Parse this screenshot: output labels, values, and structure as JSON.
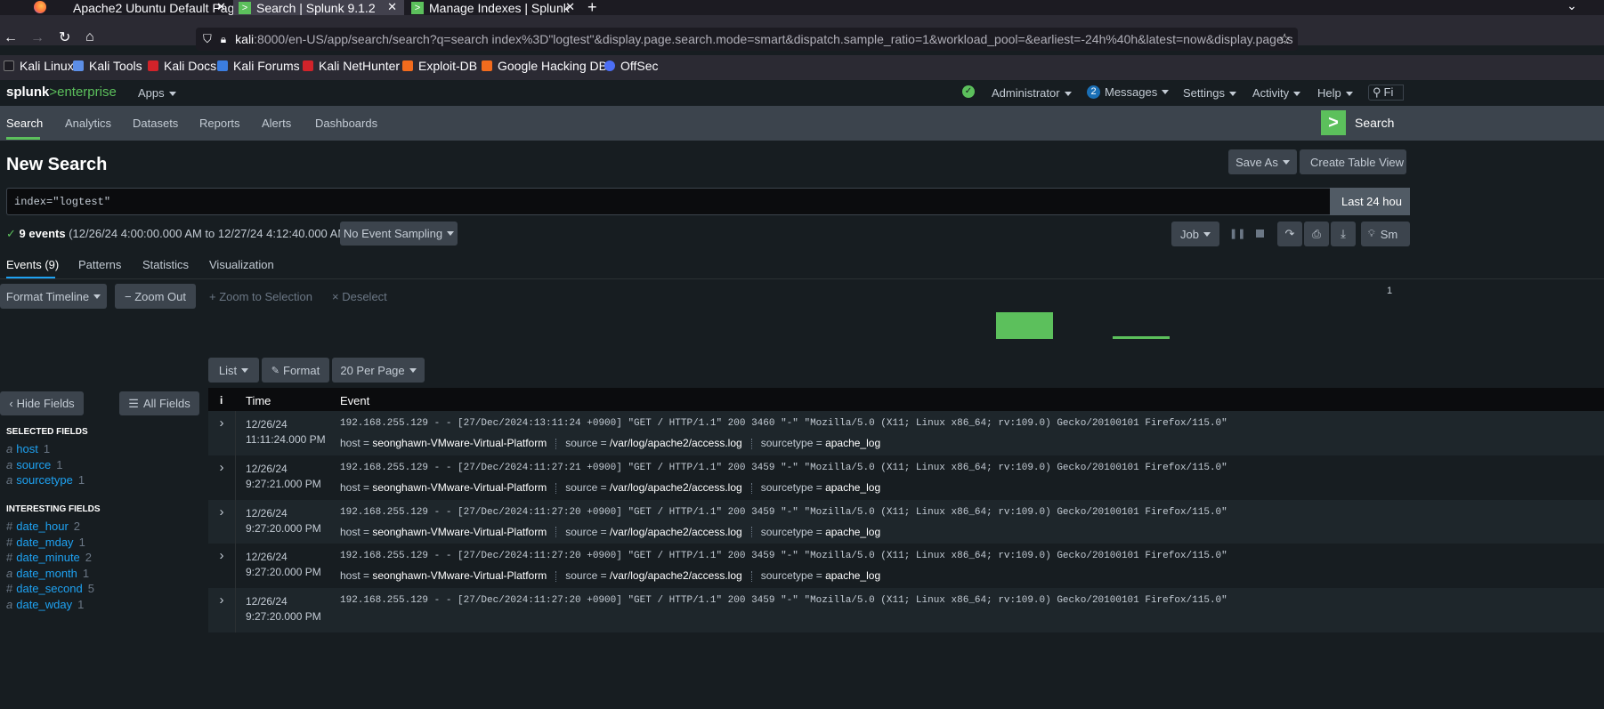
{
  "browser": {
    "tabs": [
      {
        "label": "Apache2 Ubuntu Default Pag"
      },
      {
        "label": "Search | Splunk 9.1.2"
      },
      {
        "label": "Manage Indexes | Splunk"
      }
    ],
    "new_tab": "+",
    "url_host": "kali",
    "url_rest": ":8000/en-US/app/search/search?q=search index%3D\"logtest\"&display.page.search.mode=smart&dispatch.sample_ratio=1&workload_pool=&earliest=-24h%40h&latest=now&display.page.s",
    "bookmarks": [
      {
        "label": "Kali Linux",
        "color": "#2b2a33"
      },
      {
        "label": "Kali Tools",
        "color": "#5c8ee6"
      },
      {
        "label": "Kali Docs",
        "color": "#d1232a"
      },
      {
        "label": "Kali Forums",
        "color": "#3b7de0"
      },
      {
        "label": "Kali NetHunter",
        "color": "#d1232a"
      },
      {
        "label": "Exploit-DB",
        "color": "#f26b1d"
      },
      {
        "label": "Google Hacking DB",
        "color": "#f26b1d"
      },
      {
        "label": "OffSec",
        "color": "#4c6ef5"
      }
    ]
  },
  "splunk": {
    "logo_a": "splunk",
    "logo_b": ">enterprise",
    "apps": "Apps",
    "user": "Administrator",
    "messages_count": "2",
    "messages": "Messages",
    "settings": "Settings",
    "activity": "Activity",
    "help": "Help",
    "find": "Fi",
    "app_nav": [
      "Search",
      "Analytics",
      "Datasets",
      "Reports",
      "Alerts",
      "Dashboards"
    ],
    "app_title": "Search",
    "accent": "#5cc05c",
    "link_color": "#1ea2f2"
  },
  "search": {
    "page_title": "New Search",
    "save_as": "Save As",
    "create_table": "Create Table View",
    "query": "index=\"logtest\"",
    "time_range": "Last 24 hou",
    "status_count": "9 events",
    "status_range": "(12/26/24 4:00:00.000 AM to 12/27/24 4:12:40.000 AM)",
    "sampling": "No Event Sampling",
    "job": "Job",
    "smart": "Sm"
  },
  "result_tabs": [
    "Events (9)",
    "Patterns",
    "Statistics",
    "Visualization"
  ],
  "timeline": {
    "format": "Format Timeline",
    "zoom_out": "− Zoom Out",
    "zoom_sel": "+ Zoom to Selection",
    "deselect": "× Deselect",
    "scale": "1"
  },
  "events_toolbar": {
    "list": "List",
    "format": "Format",
    "per_page": "20 Per Page"
  },
  "fields": {
    "hide": "Hide Fields",
    "all": "All Fields",
    "selected_header": "SELECTED FIELDS",
    "selected": [
      {
        "type": "a",
        "name": "host",
        "count": "1"
      },
      {
        "type": "a",
        "name": "source",
        "count": "1"
      },
      {
        "type": "a",
        "name": "sourcetype",
        "count": "1"
      }
    ],
    "interesting_header": "INTERESTING FIELDS",
    "interesting": [
      {
        "type": "#",
        "name": "date_hour",
        "count": "2"
      },
      {
        "type": "#",
        "name": "date_mday",
        "count": "1"
      },
      {
        "type": "#",
        "name": "date_minute",
        "count": "2"
      },
      {
        "type": "a",
        "name": "date_month",
        "count": "1"
      },
      {
        "type": "#",
        "name": "date_second",
        "count": "5"
      },
      {
        "type": "a",
        "name": "date_wday",
        "count": "1"
      }
    ]
  },
  "table": {
    "col_i": "i",
    "col_time": "Time",
    "col_event": "Event",
    "meta_keys": {
      "host": "host =",
      "source": "source =",
      "sourcetype": "sourcetype ="
    },
    "rows": [
      {
        "date": "12/26/24",
        "time": "11:11:24.000 PM",
        "raw": "192.168.255.129 - - [27/Dec/2024:13:11:24 +0900] \"GET / HTTP/1.1\" 200 3460 \"-\" \"Mozilla/5.0 (X11; Linux x86_64; rv:109.0) Gecko/20100101 Firefox/115.0\"",
        "host": "seonghawn-VMware-Virtual-Platform",
        "source": "/var/log/apache2/access.log",
        "sourcetype": "apache_log"
      },
      {
        "date": "12/26/24",
        "time": "9:27:21.000 PM",
        "raw": "192.168.255.129 - - [27/Dec/2024:11:27:21 +0900] \"GET / HTTP/1.1\" 200 3459 \"-\" \"Mozilla/5.0 (X11; Linux x86_64; rv:109.0) Gecko/20100101 Firefox/115.0\"",
        "host": "seonghawn-VMware-Virtual-Platform",
        "source": "/var/log/apache2/access.log",
        "sourcetype": "apache_log"
      },
      {
        "date": "12/26/24",
        "time": "9:27:20.000 PM",
        "raw": "192.168.255.129 - - [27/Dec/2024:11:27:20 +0900] \"GET / HTTP/1.1\" 200 3459 \"-\" \"Mozilla/5.0 (X11; Linux x86_64; rv:109.0) Gecko/20100101 Firefox/115.0\"",
        "host": "seonghawn-VMware-Virtual-Platform",
        "source": "/var/log/apache2/access.log",
        "sourcetype": "apache_log"
      },
      {
        "date": "12/26/24",
        "time": "9:27:20.000 PM",
        "raw": "192.168.255.129 - - [27/Dec/2024:11:27:20 +0900] \"GET / HTTP/1.1\" 200 3459 \"-\" \"Mozilla/5.0 (X11; Linux x86_64; rv:109.0) Gecko/20100101 Firefox/115.0\"",
        "host": "seonghawn-VMware-Virtual-Platform",
        "source": "/var/log/apache2/access.log",
        "sourcetype": "apache_log"
      },
      {
        "date": "12/26/24",
        "time": "9:27:20.000 PM",
        "raw": "192.168.255.129 - - [27/Dec/2024:11:27:20 +0900] \"GET / HTTP/1.1\" 200 3459 \"-\" \"Mozilla/5.0 (X11; Linux x86_64; rv:109.0) Gecko/20100101 Firefox/115.0\"",
        "host": "",
        "source": "",
        "sourcetype": ""
      }
    ]
  }
}
